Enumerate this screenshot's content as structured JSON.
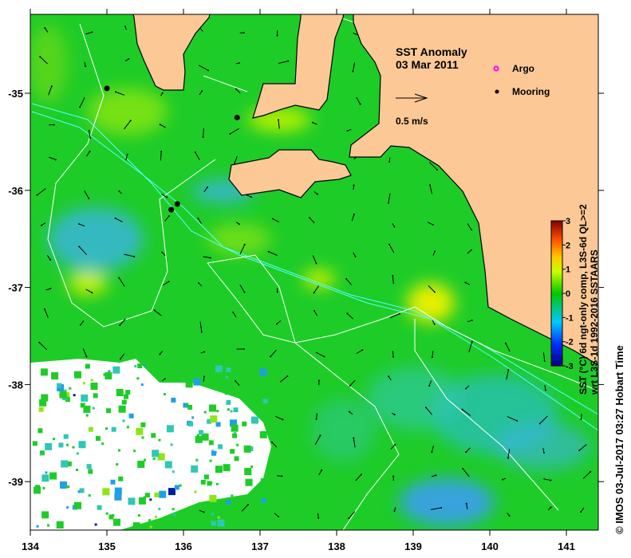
{
  "map": {
    "title": "SST Anomaly",
    "date": "03 Mar 2011",
    "scale_arrow_label": "0.5 m/s",
    "legend": [
      {
        "label": "Argo",
        "symbol": "magenta-circle",
        "color": "#ff00ff"
      },
      {
        "label": "Mooring",
        "symbol": "black-dot",
        "color": "#000000"
      }
    ],
    "x_ticks": [
      "134",
      "135",
      "136",
      "137",
      "138",
      "139",
      "140",
      "141"
    ],
    "x_tick_values": [
      134,
      135,
      136,
      137,
      138,
      139,
      140,
      141
    ],
    "y_ticks": [
      "-35",
      "-36",
      "-37",
      "-38",
      "-39"
    ],
    "y_tick_values": [
      -35,
      -36,
      -37,
      -38,
      -39
    ],
    "lon_range": [
      134,
      141.42
    ],
    "lat_range": [
      -39.5,
      -34.19
    ],
    "moorings": [
      {
        "lon": 135.0,
        "lat": -34.95
      },
      {
        "lon": 136.7,
        "lat": -35.25
      },
      {
        "lon": 135.92,
        "lat": -36.14
      },
      {
        "lon": 135.84,
        "lat": -36.2
      }
    ],
    "colors": {
      "land": "#fbc896",
      "ocean": "#1ecc28",
      "cloud": "#ffffff",
      "coast": "#000000"
    }
  },
  "colorbar": {
    "ticks": [
      "3",
      "2",
      "1",
      "0",
      "-1",
      "-2",
      "-3"
    ],
    "tick_values": [
      3,
      2,
      1,
      0,
      -1,
      -2,
      -3
    ],
    "range": [
      -3,
      3
    ],
    "label_line1": "SST (°C) 6d ngt-only comp, L3S-6d QL>=2",
    "label_line2": "wrt L3S-1d 1992-2016 SSTAARS",
    "colormap": [
      "#00007f",
      "#0030ff",
      "#00c8ff",
      "#00c800",
      "#c8ff00",
      "#ffc800",
      "#ff5000",
      "#7f0000"
    ]
  },
  "credit": "©  IMOS 03-Jul-2017 03:27 Hobart Time"
}
